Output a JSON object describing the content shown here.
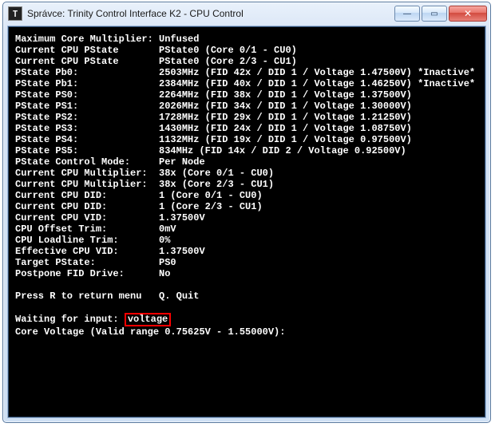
{
  "window": {
    "title": "Správce:  Trinity Control Interface K2 - CPU Control"
  },
  "rows": [
    {
      "label": "Maximum Core Multiplier:",
      "value": "Unfused"
    },
    {
      "label": "Current CPU PState",
      "value": "PState0 (Core 0/1 - CU0)"
    },
    {
      "label": "Current CPU PState",
      "value": "PState0 (Core 2/3 - CU1)"
    },
    {
      "label": "PState Pb0:",
      "value": "2503MHz (FID 42x / DID 1 / Voltage 1.47500V) *Inactive*"
    },
    {
      "label": "PState Pb1:",
      "value": "2384MHz (FID 40x / DID 1 / Voltage 1.46250V) *Inactive*"
    },
    {
      "label": "PState PS0:",
      "value": "2264MHz (FID 38x / DID 1 / Voltage 1.37500V)"
    },
    {
      "label": "PState PS1:",
      "value": "2026MHz (FID 34x / DID 1 / Voltage 1.30000V)"
    },
    {
      "label": "PState PS2:",
      "value": "1728MHz (FID 29x / DID 1 / Voltage 1.21250V)"
    },
    {
      "label": "PState PS3:",
      "value": "1430MHz (FID 24x / DID 1 / Voltage 1.08750V)"
    },
    {
      "label": "PState PS4:",
      "value": "1132MHz (FID 19x / DID 1 / Voltage 0.97500V)"
    },
    {
      "label": "PState PS5:",
      "value": "834MHz (FID 14x / DID 2 / Voltage 0.92500V)"
    },
    {
      "label": "PState Control Mode:",
      "value": "Per Node"
    },
    {
      "label": "Current CPU Multiplier:",
      "value": "38x (Core 0/1 - CU0)"
    },
    {
      "label": "Current CPU Multiplier:",
      "value": "38x (Core 2/3 - CU1)"
    },
    {
      "label": "Current CPU DID:",
      "value": "1 (Core 0/1 - CU0)"
    },
    {
      "label": "Current CPU DID:",
      "value": "1 (Core 2/3 - CU1)"
    },
    {
      "label": "Current CPU VID:",
      "value": "1.37500V"
    },
    {
      "label": "CPU Offset Trim:",
      "value": "0mV"
    },
    {
      "label": "CPU Loadline Trim:",
      "value": "0%"
    },
    {
      "label": "Effective CPU VID:",
      "value": "1.37500V"
    },
    {
      "label": "Target PState:",
      "value": "PS0"
    },
    {
      "label": "Postpone FID Drive:",
      "value": "No"
    }
  ],
  "menu": {
    "label": "Press R to return menu",
    "value": "Q. Quit"
  },
  "col": 25,
  "input_prefix": "Waiting for input: ",
  "input_value": "voltage",
  "range_line": "Core Voltage (Valid range 0.75625V - 1.55000V):"
}
